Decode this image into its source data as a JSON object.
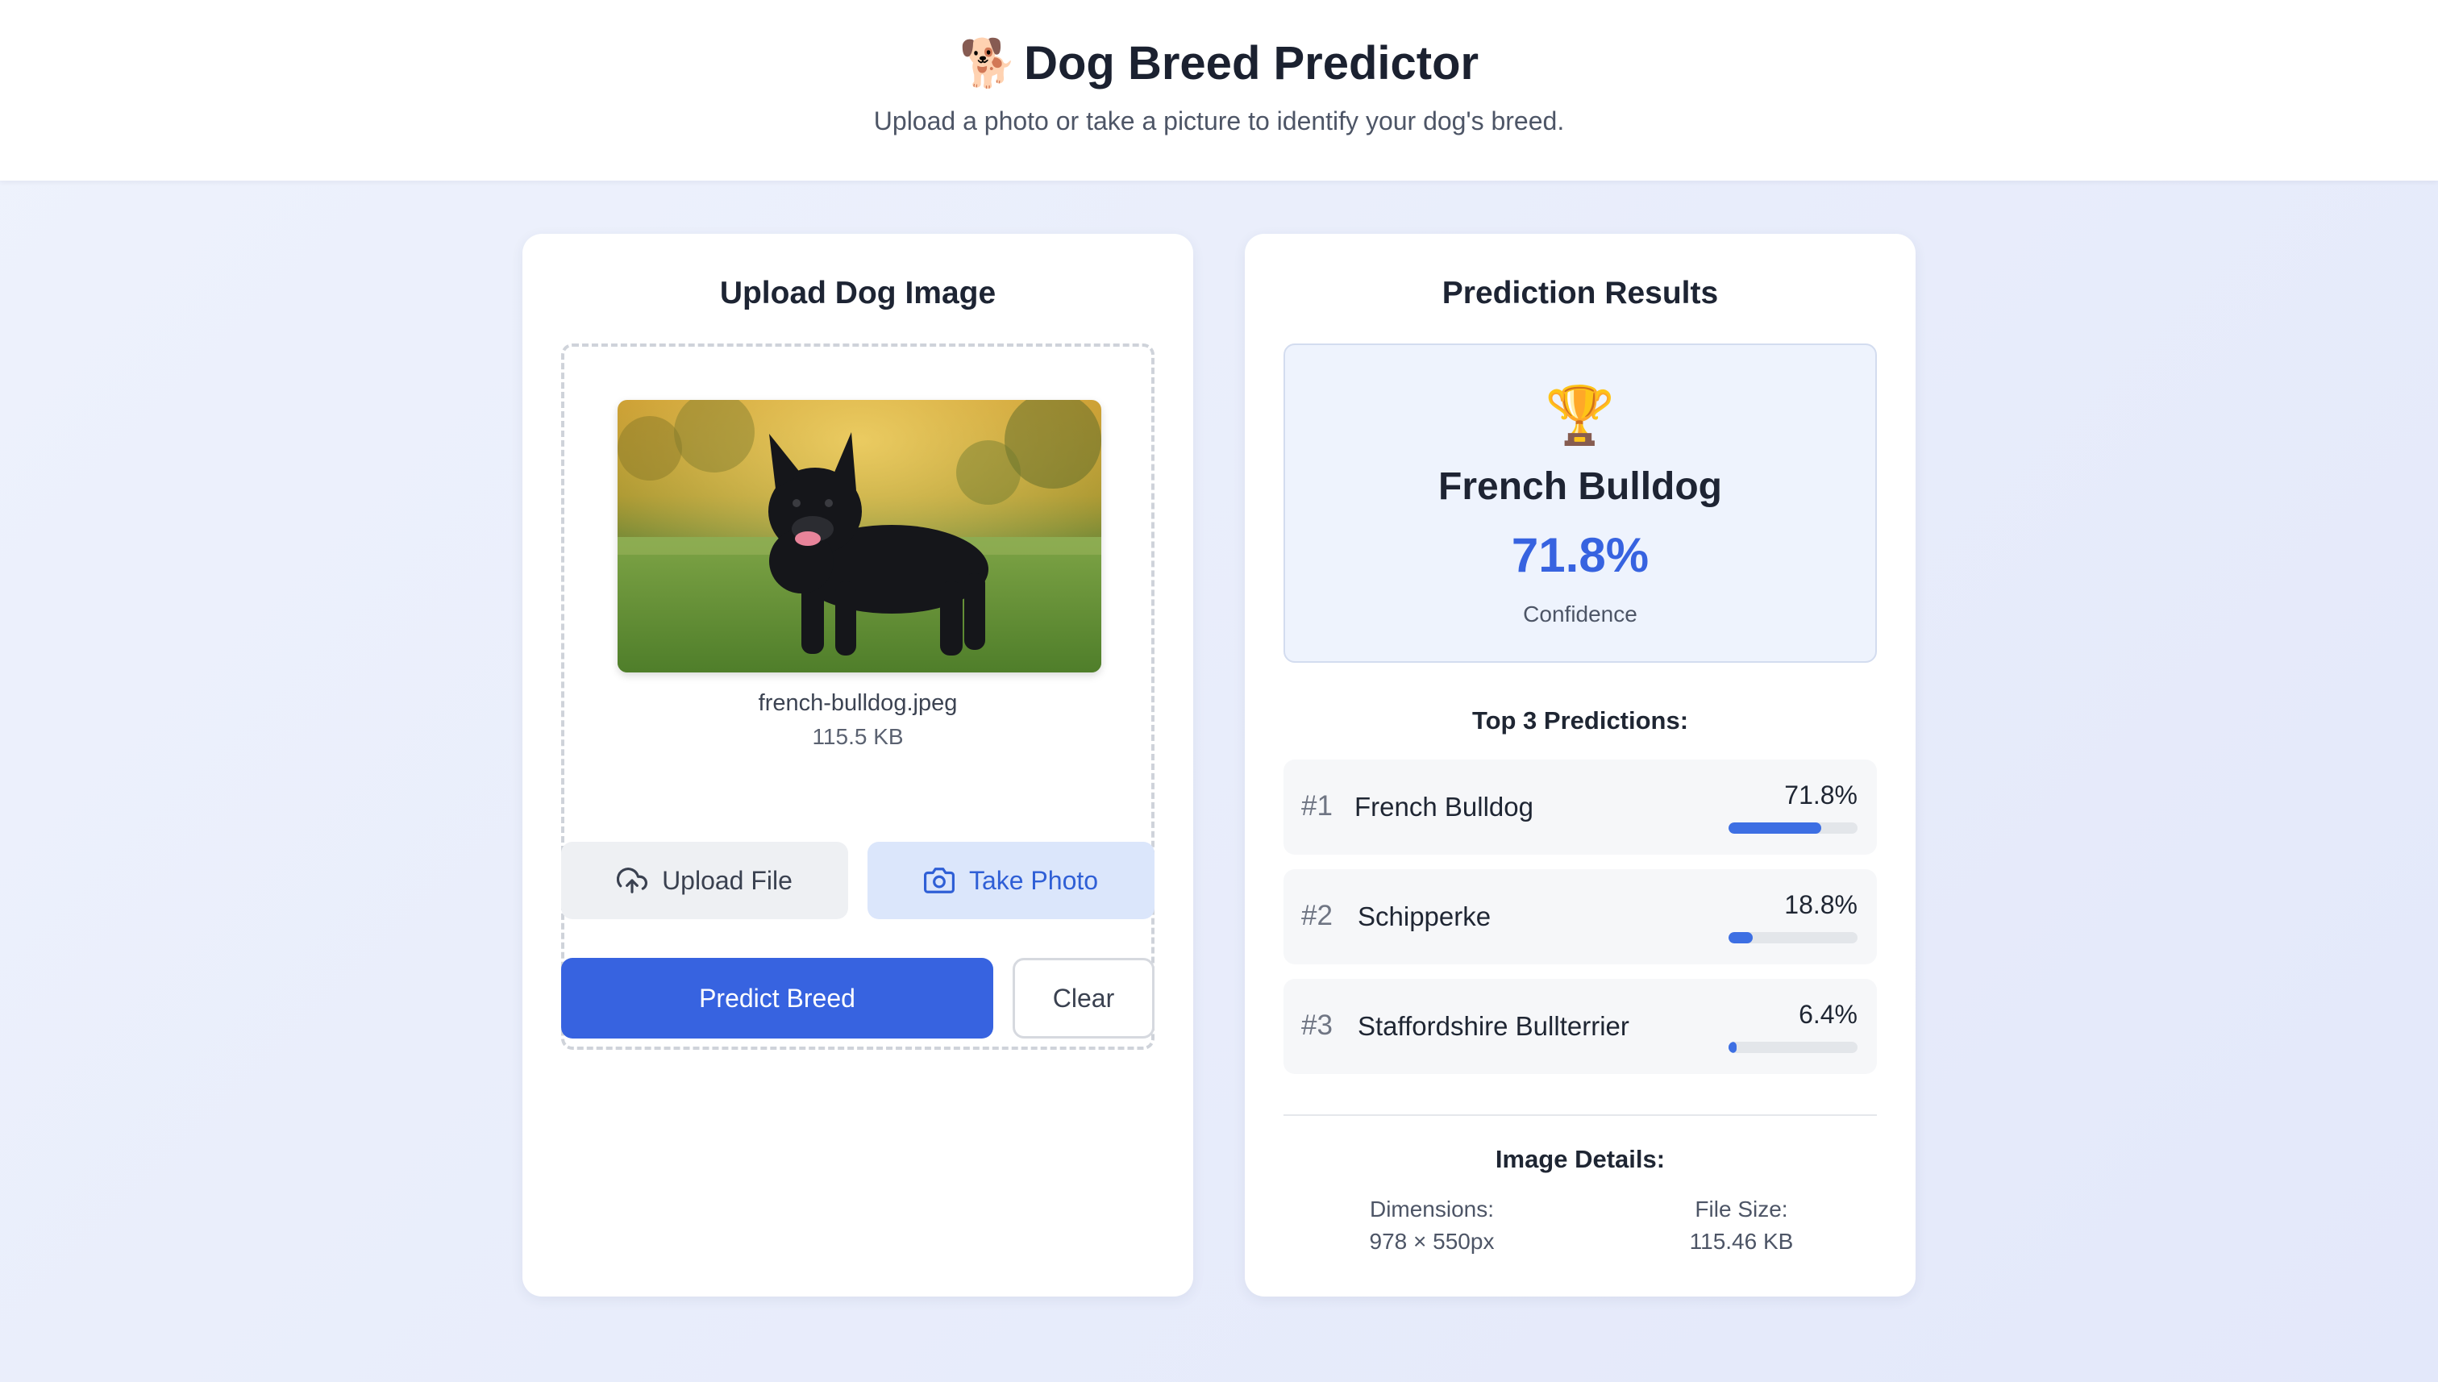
{
  "header": {
    "emoji": "🐕",
    "title": "Dog Breed Predictor",
    "subtitle": "Upload a photo or take a picture to identify your dog's breed."
  },
  "upload": {
    "title": "Upload Dog Image",
    "file_name": "french-bulldog.jpeg",
    "file_size": "115.5 KB",
    "upload_label": "Upload File",
    "photo_label": "Take Photo",
    "predict_label": "Predict Breed",
    "clear_label": "Clear"
  },
  "results": {
    "title": "Prediction Results",
    "trophy": "🏆",
    "top_breed": "French Bulldog",
    "top_confidence": "71.8%",
    "confidence_label": "Confidence",
    "top3_title": "Top 3 Predictions:",
    "predictions": [
      {
        "rank": "#1",
        "name": "French Bulldog",
        "percent": "71.8%",
        "value": 71.8
      },
      {
        "rank": "#2",
        "name": "Schipperke",
        "percent": "18.8%",
        "value": 18.8
      },
      {
        "rank": "#3",
        "name": "Staffordshire Bullterrier",
        "percent": "6.4%",
        "value": 6.4
      }
    ],
    "details_title": "Image Details:",
    "dimensions_label": "Dimensions:",
    "dimensions_value": "978 × 550px",
    "filesize_label": "File Size:",
    "filesize_value": "115.46 KB"
  },
  "colors": {
    "accent": "#3763e0",
    "photo_button_bg": "#dbe6fb",
    "bar_fill": "#3d6fe3"
  },
  "icons": {
    "upload": "cloud-upload-icon",
    "camera": "camera-icon"
  }
}
